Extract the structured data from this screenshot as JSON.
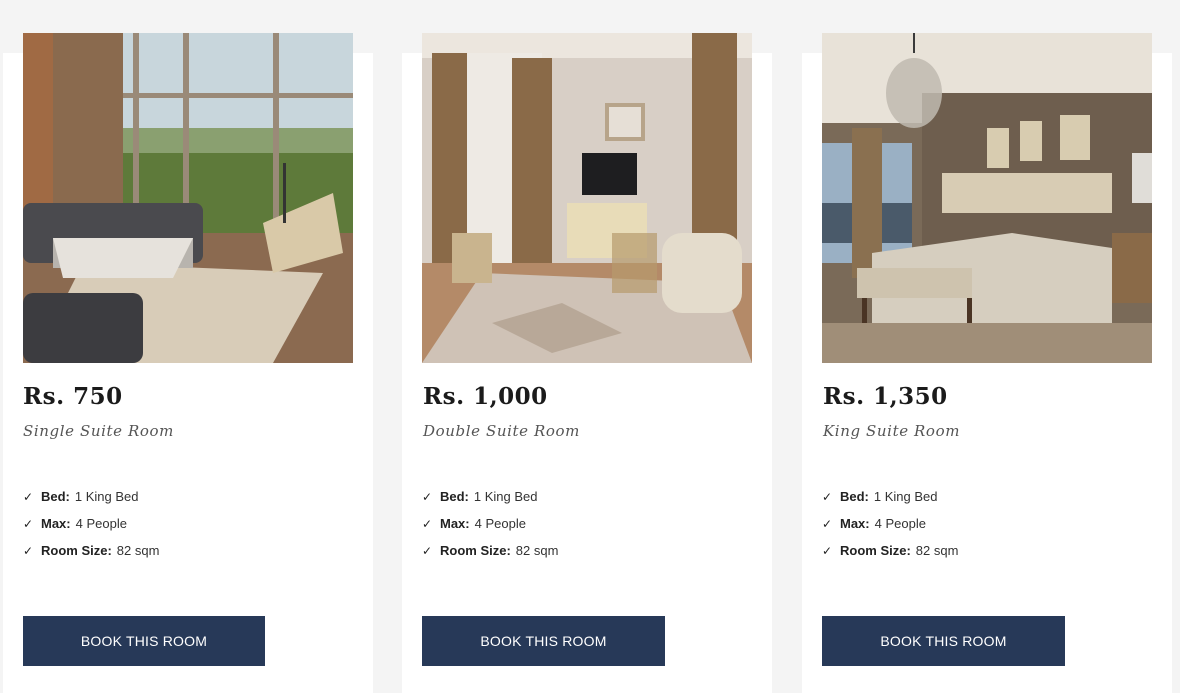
{
  "rooms": [
    {
      "price": "Rs. 750",
      "name": "Single Suite Room",
      "features": [
        {
          "label": "Bed:",
          "value": "1 King Bed"
        },
        {
          "label": "Max:",
          "value": "4 People"
        },
        {
          "label": "Room Size:",
          "value": "82 sqm"
        }
      ],
      "button_label": "BOOK THIS ROOM"
    },
    {
      "price": "Rs. 1,000",
      "name": "Double Suite Room",
      "features": [
        {
          "label": "Bed:",
          "value": "1 King Bed"
        },
        {
          "label": "Max:",
          "value": "4 People"
        },
        {
          "label": "Room Size:",
          "value": "82 sqm"
        }
      ],
      "button_label": "BOOK THIS ROOM"
    },
    {
      "price": "Rs. 1,350",
      "name": "King Suite Room",
      "features": [
        {
          "label": "Bed:",
          "value": "1 King Bed"
        },
        {
          "label": "Max:",
          "value": "4 People"
        },
        {
          "label": "Room Size:",
          "value": "82 sqm"
        }
      ],
      "button_label": "BOOK THIS ROOM"
    }
  ],
  "icons": {
    "feature_check": "check-icon"
  },
  "colors": {
    "button_bg": "#273958",
    "page_bg": "#f4f4f4"
  }
}
